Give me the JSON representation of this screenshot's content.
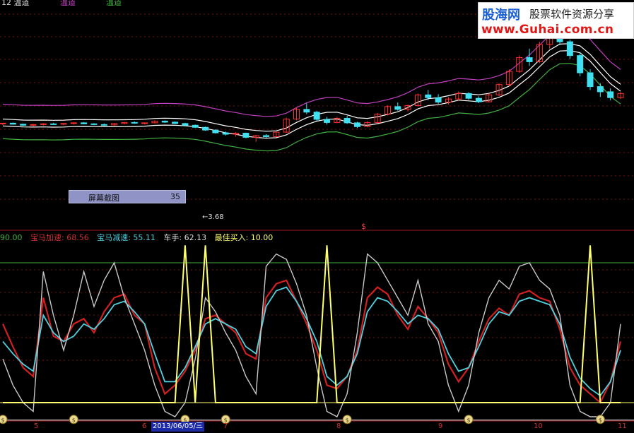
{
  "colors": {
    "background": "#000000",
    "candle_up": "#ff3030",
    "candle_down": "#40e0f0",
    "band_upper": "#c040c0",
    "band_lower": "#40b040",
    "band_mid": "#ffffff",
    "jiasu": "#d02020",
    "jiansu": "#50d0e0",
    "chezhou": "#c8c8c8",
    "buy": "#ffff70"
  },
  "top_header": {
    "left": "12 温道",
    "upper": "温道",
    "lower": "温道"
  },
  "logo": {
    "name": "股海网",
    "slogan": "股票软件资源分享",
    "url": "www.Guhai.com.cn"
  },
  "screenshot_popup": {
    "label": "屏幕截图",
    "number": "35"
  },
  "price_low_label": "←3.68",
  "signal_marker": "$",
  "indicator_legend": {
    "first_value": "90.00",
    "jiasu_label": "宝马加速: 68.56",
    "jiansu_label": "宝马减速: 55.11",
    "chezhou_label": "车手: 62.13",
    "buy_label": "最佳买入: 10.00"
  },
  "x_axis": {
    "ticks": [
      "5",
      "6",
      "7",
      "8",
      "9",
      "10",
      "11"
    ],
    "cursor_date": "2013/06/05/三"
  },
  "chart_data": {
    "type": "line",
    "series": [
      {
        "name": "宝马加速",
        "values": [
          55,
          42,
          30,
          25,
          70,
          48,
          45,
          55,
          58,
          50,
          62,
          70,
          72,
          60,
          55,
          30,
          15,
          20,
          28,
          40,
          58,
          60,
          55,
          50,
          38,
          35,
          70,
          78,
          80,
          68,
          55,
          40,
          20,
          18,
          25,
          40,
          70,
          76,
          72,
          60,
          52,
          65,
          58,
          50,
          32,
          22,
          30,
          45,
          58,
          64,
          60,
          72,
          74,
          70,
          68,
          52,
          30,
          20,
          15,
          10,
          22,
          45
        ]
      },
      {
        "name": "宝马减速",
        "values": [
          45,
          38,
          32,
          28,
          60,
          50,
          45,
          48,
          55,
          52,
          58,
          66,
          68,
          62,
          55,
          38,
          22,
          22,
          30,
          42,
          55,
          58,
          55,
          52,
          42,
          38,
          65,
          74,
          76,
          68,
          58,
          45,
          25,
          20,
          25,
          38,
          62,
          70,
          68,
          62,
          55,
          60,
          58,
          52,
          38,
          28,
          30,
          42,
          55,
          62,
          60,
          68,
          70,
          68,
          66,
          55,
          36,
          24,
          18,
          14,
          22,
          40
        ]
      },
      {
        "name": "车手",
        "values": [
          35,
          20,
          10,
          5,
          85,
          60,
          40,
          60,
          85,
          65,
          80,
          90,
          70,
          55,
          40,
          20,
          5,
          0,
          10,
          35,
          70,
          62,
          50,
          40,
          25,
          15,
          88,
          95,
          92,
          78,
          60,
          30,
          5,
          0,
          15,
          50,
          95,
          90,
          80,
          70,
          60,
          80,
          55,
          45,
          20,
          5,
          20,
          50,
          70,
          80,
          75,
          88,
          90,
          80,
          75,
          60,
          20,
          5,
          0,
          -5,
          10,
          55
        ]
      },
      {
        "name": "最佳买入",
        "values": [
          10,
          10,
          10,
          10,
          10,
          10,
          10,
          10,
          10,
          10,
          10,
          10,
          10,
          10,
          10,
          10,
          10,
          10,
          100,
          10,
          100,
          10,
          10,
          10,
          10,
          10,
          10,
          10,
          10,
          10,
          10,
          10,
          100,
          10,
          10,
          10,
          10,
          10,
          10,
          10,
          10,
          10,
          10,
          10,
          10,
          10,
          10,
          10,
          10,
          10,
          10,
          10,
          10,
          10,
          10,
          10,
          10,
          10,
          100,
          10,
          10,
          10
        ]
      }
    ],
    "reference_lines": [
      90,
      10,
      0
    ],
    "candles": [
      [
        6.42,
        6.45,
        6.38,
        6.44
      ],
      [
        6.44,
        6.46,
        6.4,
        6.41
      ],
      [
        6.41,
        6.43,
        6.36,
        6.38
      ],
      [
        6.38,
        6.42,
        6.35,
        6.4
      ],
      [
        6.4,
        6.44,
        6.37,
        6.42
      ],
      [
        6.42,
        6.45,
        6.39,
        6.41
      ],
      [
        6.41,
        6.44,
        6.38,
        6.43
      ],
      [
        6.43,
        6.47,
        6.4,
        6.45
      ],
      [
        6.45,
        6.47,
        6.41,
        6.42
      ],
      [
        6.42,
        6.44,
        6.38,
        6.4
      ],
      [
        6.4,
        6.43,
        6.36,
        6.39
      ],
      [
        6.39,
        6.44,
        6.37,
        6.43
      ],
      [
        6.43,
        6.47,
        6.41,
        6.46
      ],
      [
        6.46,
        6.49,
        6.42,
        6.44
      ],
      [
        6.44,
        6.46,
        6.4,
        6.45
      ],
      [
        6.45,
        6.52,
        6.44,
        6.5
      ],
      [
        6.5,
        6.52,
        6.45,
        6.47
      ],
      [
        6.47,
        6.49,
        6.42,
        6.43
      ],
      [
        6.43,
        6.45,
        6.37,
        6.38
      ],
      [
        6.38,
        6.4,
        6.3,
        6.32
      ],
      [
        6.32,
        6.34,
        6.22,
        6.24
      ],
      [
        6.24,
        6.26,
        6.14,
        6.16
      ],
      [
        6.16,
        6.2,
        6.08,
        6.12
      ],
      [
        6.12,
        6.18,
        6.05,
        6.15
      ],
      [
        6.15,
        6.17,
        6.0,
        6.03
      ],
      [
        6.03,
        6.1,
        3.68,
        6.08
      ],
      [
        6.08,
        6.12,
        6.02,
        6.05
      ],
      [
        6.05,
        6.2,
        6.03,
        6.18
      ],
      [
        6.18,
        6.6,
        6.16,
        6.56
      ],
      [
        6.56,
        6.9,
        6.52,
        6.84
      ],
      [
        6.84,
        7.02,
        6.7,
        6.76
      ],
      [
        6.76,
        6.8,
        6.5,
        6.55
      ],
      [
        6.55,
        6.62,
        6.4,
        6.46
      ],
      [
        6.46,
        6.62,
        6.44,
        6.58
      ],
      [
        6.58,
        6.66,
        6.42,
        6.45
      ],
      [
        6.45,
        6.48,
        6.3,
        6.34
      ],
      [
        6.34,
        6.5,
        6.32,
        6.46
      ],
      [
        6.46,
        6.74,
        6.44,
        6.7
      ],
      [
        6.7,
        6.96,
        6.66,
        6.92
      ],
      [
        6.92,
        7.04,
        6.8,
        6.84
      ],
      [
        6.84,
        6.98,
        6.78,
        6.95
      ],
      [
        6.95,
        7.3,
        6.92,
        7.26
      ],
      [
        7.26,
        7.4,
        7.1,
        7.18
      ],
      [
        7.18,
        7.28,
        7.0,
        7.05
      ],
      [
        7.05,
        7.2,
        6.98,
        7.14
      ],
      [
        7.14,
        7.36,
        7.1,
        7.3
      ],
      [
        7.3,
        7.34,
        7.12,
        7.16
      ],
      [
        7.16,
        7.22,
        7.02,
        7.06
      ],
      [
        7.06,
        7.3,
        7.04,
        7.26
      ],
      [
        7.26,
        7.6,
        7.22,
        7.56
      ],
      [
        7.56,
        8.0,
        7.5,
        7.94
      ],
      [
        7.94,
        8.4,
        7.9,
        8.34
      ],
      [
        8.34,
        8.6,
        8.1,
        8.22
      ],
      [
        8.22,
        8.8,
        8.18,
        8.72
      ],
      [
        8.72,
        9.1,
        8.6,
        8.98
      ],
      [
        8.98,
        9.2,
        8.7,
        8.8
      ],
      [
        8.8,
        8.86,
        8.3,
        8.4
      ],
      [
        8.4,
        8.5,
        7.8,
        7.9
      ],
      [
        7.9,
        8.0,
        7.4,
        7.5
      ],
      [
        7.5,
        7.6,
        7.2,
        7.35
      ],
      [
        7.35,
        7.45,
        7.1,
        7.18
      ],
      [
        7.18,
        7.34,
        7.14,
        7.3
      ]
    ]
  }
}
